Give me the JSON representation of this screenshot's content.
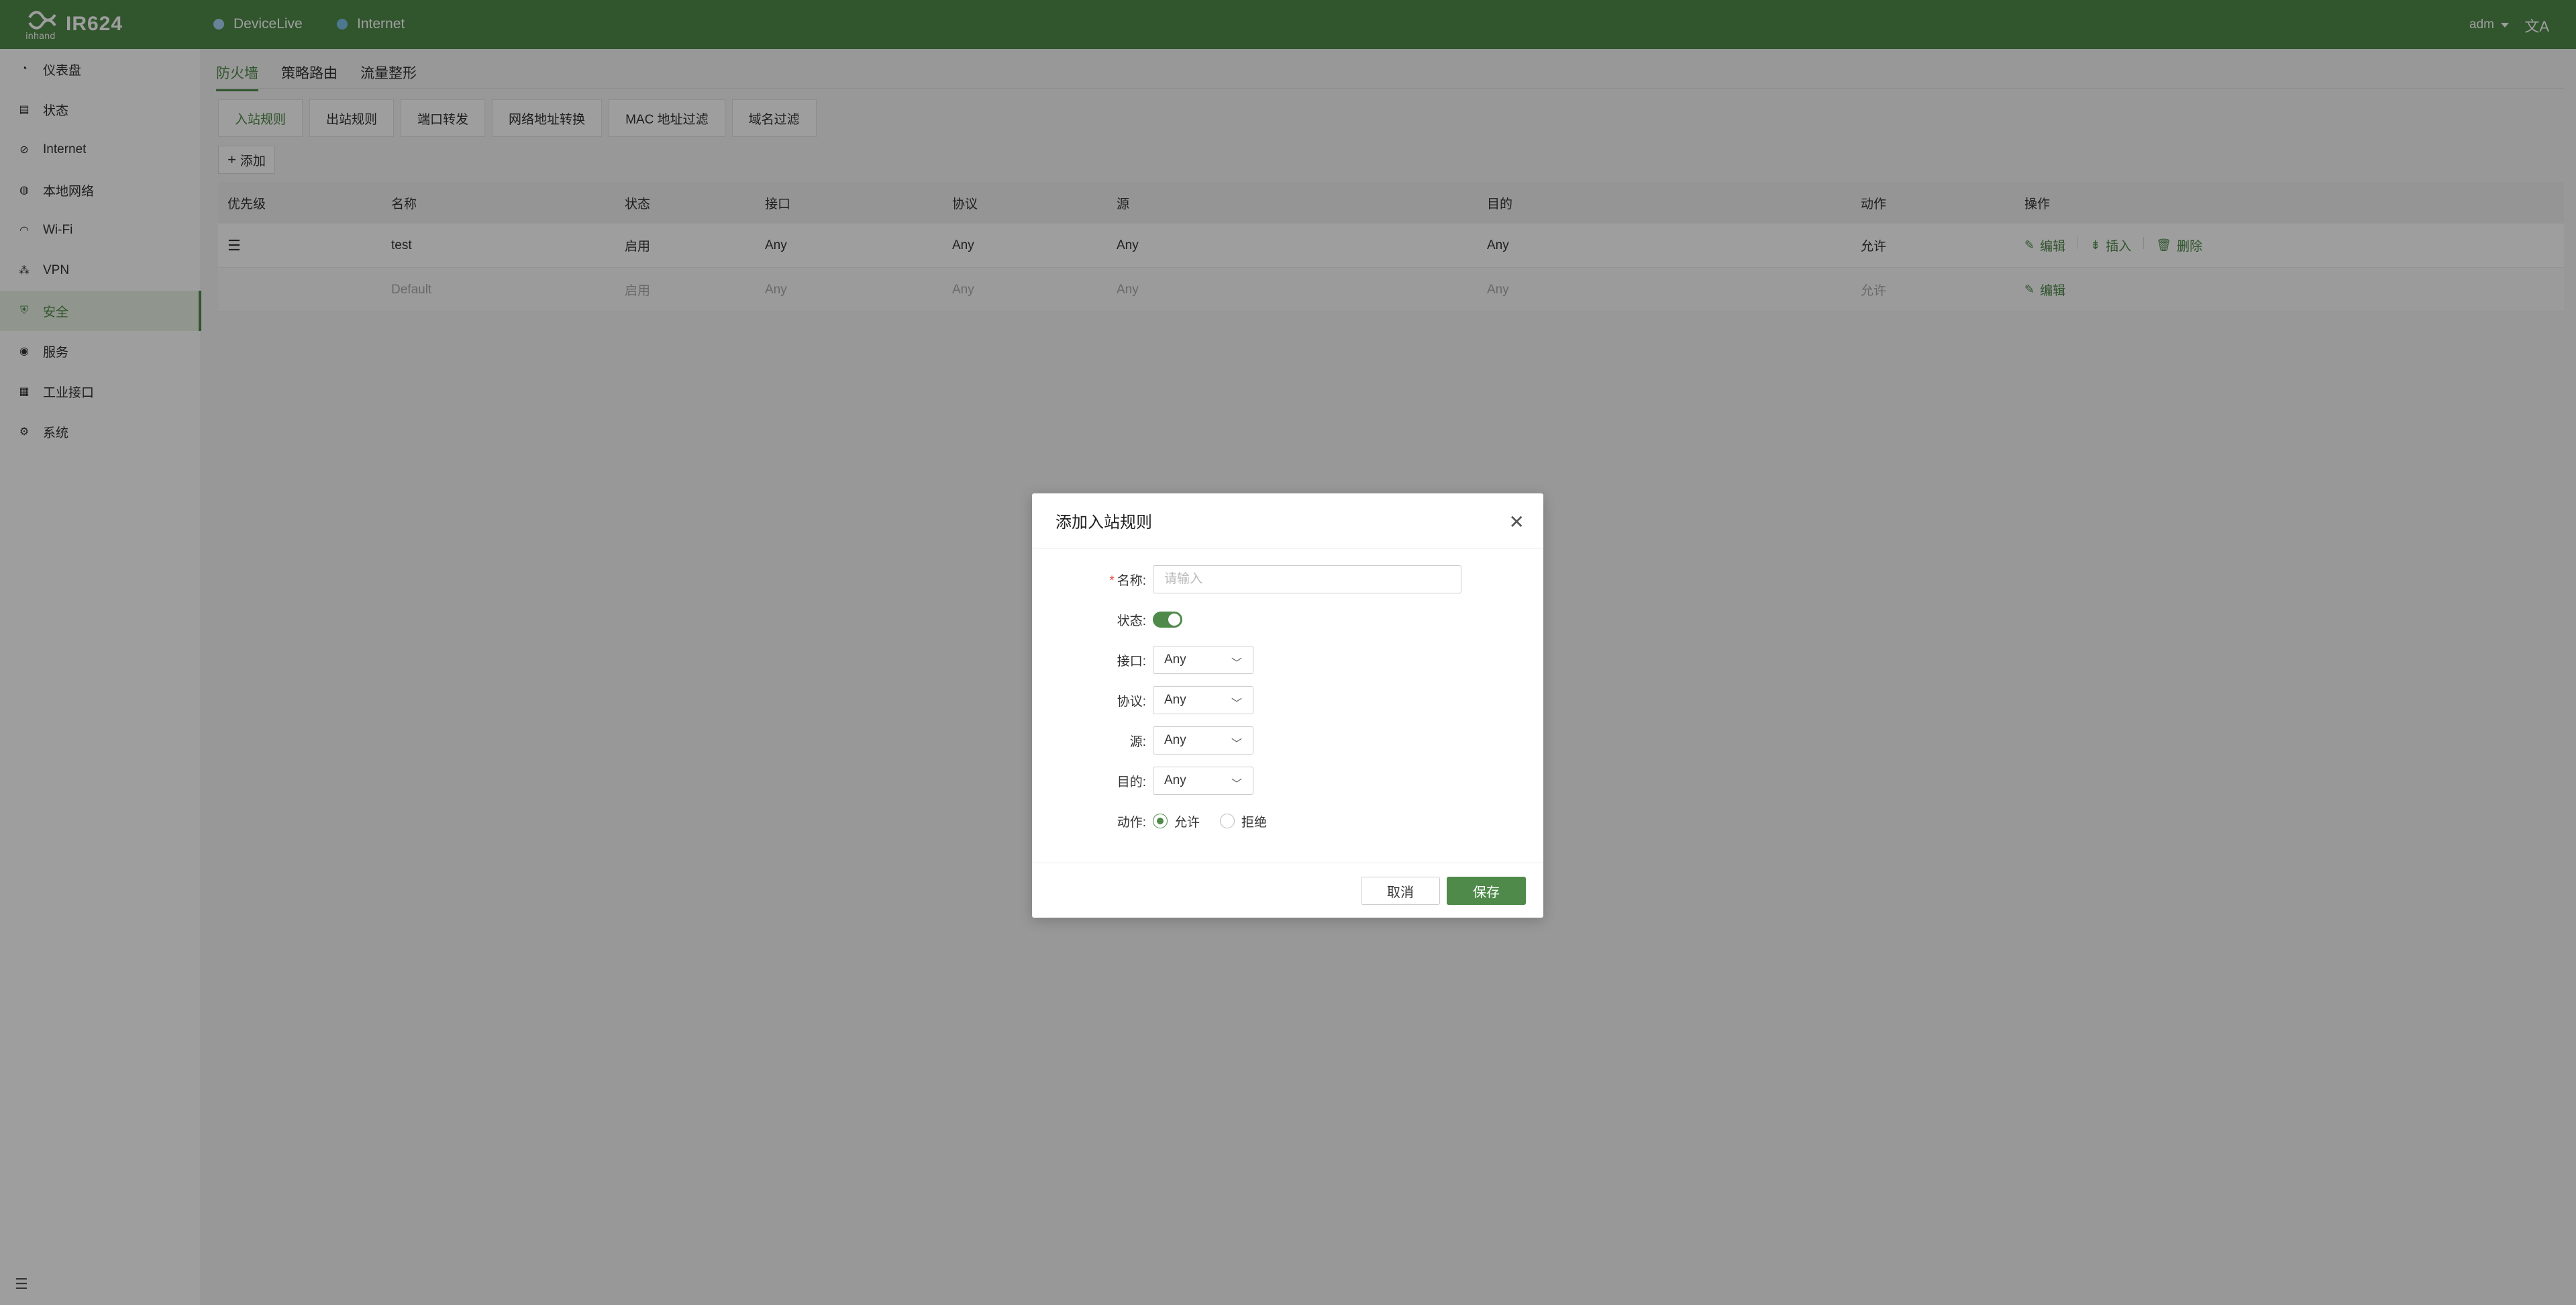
{
  "header": {
    "product": "IR624",
    "status_items": [
      {
        "label": "DeviceLive",
        "color": "#a9d3f5"
      },
      {
        "label": "Internet",
        "color": "#7ec2e8"
      }
    ],
    "user": "adm",
    "lang_icon": "translate-icon"
  },
  "sidebar": {
    "items": [
      {
        "label": "仪表盘",
        "icon": "dashboard-icon"
      },
      {
        "label": "状态",
        "icon": "status-icon"
      },
      {
        "label": "Internet",
        "icon": "internet-icon"
      },
      {
        "label": "本地网络",
        "icon": "lan-icon"
      },
      {
        "label": "Wi-Fi",
        "icon": "wifi-icon"
      },
      {
        "label": "VPN",
        "icon": "vpn-icon"
      },
      {
        "label": "安全",
        "icon": "shield-icon",
        "active": true
      },
      {
        "label": "服务",
        "icon": "service-icon"
      },
      {
        "label": "工业接口",
        "icon": "industrial-port-icon"
      },
      {
        "label": "系统",
        "icon": "gear-icon"
      }
    ]
  },
  "tabs": {
    "top": [
      "防火墙",
      "策略路由",
      "流量整形"
    ],
    "sub": [
      "入站规则",
      "出站规则",
      "端口转发",
      "网络地址转换",
      "MAC 地址过滤",
      "域名过滤"
    ]
  },
  "toolbar": {
    "add_label": "添加"
  },
  "table": {
    "columns": [
      "优先级",
      "名称",
      "状态",
      "接口",
      "协议",
      "源",
      "目的",
      "动作",
      "操作"
    ],
    "rows": [
      {
        "name": "test",
        "status": "启用",
        "interface": "Any",
        "protocol": "Any",
        "source": "Any",
        "destination": "Any",
        "action": "允许",
        "ops": [
          "编辑",
          "插入",
          "删除"
        ]
      },
      {
        "name": "Default",
        "status": "启用",
        "interface": "Any",
        "protocol": "Any",
        "source": "Any",
        "destination": "Any",
        "action": "允许",
        "ops": [
          "编辑"
        ]
      }
    ]
  },
  "modal": {
    "title": "添加入站规则",
    "name_label": "名称:",
    "name_placeholder": "请输入",
    "status_label": "状态:",
    "status_on": true,
    "interface_label": "接口:",
    "interface_value": "Any",
    "protocol_label": "协议:",
    "protocol_value": "Any",
    "source_label": "源:",
    "source_value": "Any",
    "destination_label": "目的:",
    "destination_value": "Any",
    "action_label": "动作:",
    "action_options": [
      "允许",
      "拒绝"
    ],
    "action_selected": "允许",
    "cancel_label": "取消",
    "save_label": "保存"
  },
  "colors": {
    "brand": "#4f8a4a",
    "required": "#e74c3c"
  }
}
